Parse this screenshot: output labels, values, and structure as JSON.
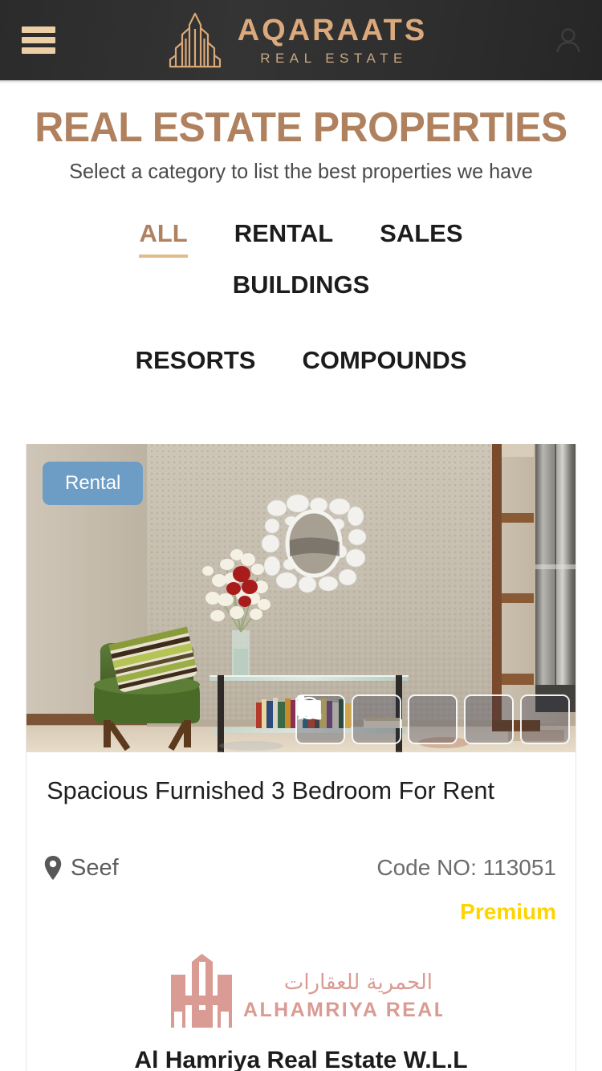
{
  "header": {
    "menu_icon": "hamburger-menu-icon",
    "account_icon": "user-account-icon",
    "logo_mark": "building-skyline-icon",
    "brand_name": "AQARAATS",
    "brand_sub": "REAL ESTATE",
    "brand_color": "#dba97b",
    "background_color": "#2e2e2e"
  },
  "page": {
    "title": "REAL ESTATE PROPERTIES",
    "subtitle": "Select a category to list the best properties we have",
    "title_color": "#b0815e"
  },
  "tabs": {
    "active_index": 0,
    "underline_color": "#e0bd8e",
    "row1": [
      {
        "label": "ALL",
        "active": true
      },
      {
        "label": "RENTAL",
        "active": false
      },
      {
        "label": "SALES",
        "active": false
      },
      {
        "label": "BUILDINGS",
        "active": false
      }
    ],
    "row2": [
      {
        "label": "RESORTS",
        "active": false
      },
      {
        "label": "COMPOUNDS",
        "active": false
      }
    ]
  },
  "listing": {
    "badge": {
      "label": "Rental",
      "background_color": "#6d9dc5",
      "text_color": "#ffffff"
    },
    "photo_alt": "interior-lobby-with-green-armchair-mirror-and-console-table",
    "actions": [
      {
        "name": "favorite-button",
        "icon": "heart-icon"
      },
      {
        "name": "compare-button",
        "icon": "compare-arrows-icon"
      },
      {
        "name": "call-button",
        "icon": "phone-icon"
      },
      {
        "name": "whatsapp-button",
        "icon": "whatsapp-icon"
      },
      {
        "name": "email-button",
        "icon": "envelope-icon"
      }
    ],
    "title": "Spacious Furnished 3 Bedroom For Rent",
    "location_icon": "map-pin-icon",
    "location": "Seef",
    "code": "Code NO: 113051",
    "premium_label": "Premium",
    "premium_color": "#FFD400",
    "agency": {
      "logo_icon": "alhamriya-building-logo-icon",
      "logo_arabic": "الحمرية للعقارات",
      "logo_latin": "ALHAMRIYA REAL ESTATE",
      "logo_color": "#d99b93",
      "name": "Al Hamriya Real Estate W.L.L"
    }
  }
}
